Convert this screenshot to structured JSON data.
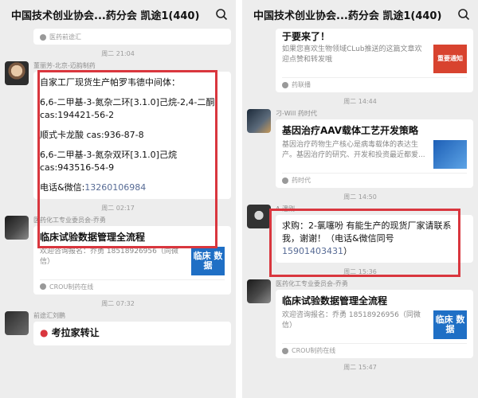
{
  "left": {
    "title": "中国技术创业协会...药分会 凯途1(440)",
    "top_card_foot": "医药前途汇",
    "ts1": "周二 21:04",
    "msg1": {
      "sender": "董丽芳-北京-迈韵制药",
      "lines": [
        "自家工厂现货生产帕罗韦德中间体：",
        "6,6-二甲基-3-氮杂二环[3.1.0]己烷-2,4-二酮 cas:194421-56-2",
        "顺式卡龙酸 cas:936-87-8",
        "6,6-二甲基-3-氮杂双环[3.1.0]己烷 cas:943516-54-9"
      ],
      "contact_label": "电话&微信:",
      "contact_phone": "13260106984"
    },
    "ts2": "周二 02:17",
    "card2": {
      "sender": "医药化工专业委员会-乔勇",
      "title": "临床试验数据管理全流程",
      "desc": "欢迎咨询报名：乔勇 18518926956（同微信）",
      "thumb": "临床 数据",
      "foot": "CROU制药在线"
    },
    "ts3": "周二 07:32",
    "card3": {
      "sender": "前途汇刘鹏",
      "title": "考拉家转让"
    }
  },
  "right": {
    "title": "中国技术创业协会...药分会 凯途1(440)",
    "top_card": {
      "title_tail": "于要来了！",
      "desc": "如果您喜欢生物领域CLub推送的这篇文章欢迎点赞和转发哦",
      "thumb": "重要通知",
      "foot": "药联播"
    },
    "ts1": "周二 14:44",
    "card1": {
      "sender": "刁-Will 药时代",
      "title": "基因治疗AAV载体工艺开发策略",
      "desc": "基因治疗药物生产核心是病毒载体的表达生产。基因治疗的研究、开发和投资最近都爱...",
      "foot": "药时代"
    },
    "ts2": "周二 14:50",
    "msg2": {
      "sender": "A 潘刚",
      "text": "求购：2-氯噻吩  有能生产的现货厂家请联系我，谢谢！（电话&微信同号 ",
      "phone": "15901403431",
      "tail": "）"
    },
    "ts3": "周二 15:36",
    "card2": {
      "sender": "医药化工专业委员会-乔勇",
      "title": "临床试验数据管理全流程",
      "desc": "欢迎咨询报名：乔勇 18518926956（同微信）",
      "thumb": "临床 数据",
      "foot": "CROU制药在线"
    },
    "ts4": "周二 15:47"
  },
  "colors": {
    "highlight": "#d9363e",
    "link": "#576b95",
    "thumb_blue": "#1f6fc5"
  }
}
